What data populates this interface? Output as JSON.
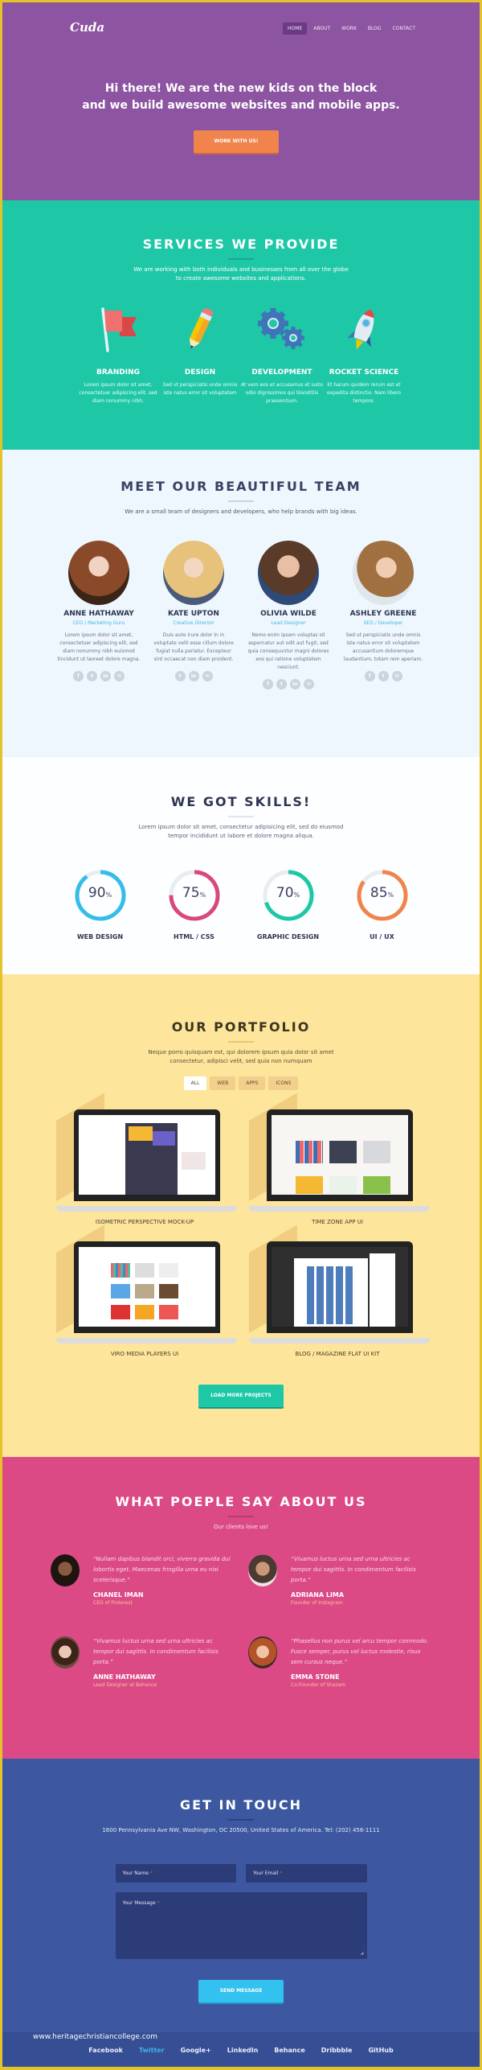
{
  "brand": {
    "logo": "Cuda"
  },
  "nav": {
    "items": [
      {
        "label": "HOME",
        "active": true
      },
      {
        "label": "ABOUT"
      },
      {
        "label": "WORK"
      },
      {
        "label": "BLOG"
      },
      {
        "label": "CONTACT"
      }
    ]
  },
  "hero": {
    "line1": "Hi there! We are the new kids on the block",
    "line2": "and we build awesome websites and mobile apps.",
    "cta": "WORK WITH US!"
  },
  "services": {
    "title": "SERVICES WE PROVIDE",
    "subtitle_1": "We are working with both individuals and businesses from all over the globe",
    "subtitle_2": "to create awesome websites and applications.",
    "items": [
      {
        "icon": "flag-icon",
        "title": "BRANDING",
        "text": "Lorem ipsum dolor sit amet, consectetuer adipiscing elit, sed diam nonummy nibh."
      },
      {
        "icon": "pencil-icon",
        "title": "DESIGN",
        "text": "Sed ut perspiciatis unde omnis iste natus error sit voluptatem"
      },
      {
        "icon": "gears-icon",
        "title": "DEVELOPMENT",
        "text": "At vero eos et accusamus et iusto odio dignissimos qui blanditiis praesentium."
      },
      {
        "icon": "rocket-icon",
        "title": "ROCKET SCIENCE",
        "text": "Et harum quidem rerum est et expedita distinctio. Nam libero tempore."
      }
    ]
  },
  "team": {
    "title": "MEET OUR BEAUTIFUL TEAM",
    "subtitle": "We are a small team of designers and developers, who help brands with big ideas.",
    "members": [
      {
        "name": "ANNE HATHAWAY",
        "role": "CEO / Marketing Guru",
        "bio": "Lorem ipsum dolor sit amet, consectetuer adipiscing elit, sed diam nonummy nibh euismod tincidunt ut laoreet dolore magna.",
        "socials": [
          "f",
          "t",
          "in",
          "✉"
        ]
      },
      {
        "name": "KATE UPTON",
        "role": "Creative Director",
        "bio": "Duis aute irure dolor in in voluptate velit esse cillum dolore fugiat nulla pariatur. Excepteur sint occaecat non diam proident.",
        "socials": [
          "t",
          "in",
          "✉"
        ]
      },
      {
        "name": "OLIVIA WILDE",
        "role": "Lead Designer",
        "bio": "Nemo enim ipsam voluptas sit aspernatur aut odit aut fugit, sed quia consequuntur magni dolores eos qui ratione voluptatem nesciunt.",
        "socials": [
          "f",
          "t",
          "in",
          "✉"
        ]
      },
      {
        "name": "ASHLEY GREENE",
        "role": "SEO / Developer",
        "bio": "Sed ut perspiciatis unde omnis iste natus error sit voluptatem accusantium doloremque laudantium, totam rem aperiam.",
        "socials": [
          "f",
          "t",
          "✉"
        ]
      }
    ]
  },
  "skills": {
    "title": "WE GOT SKILLS!",
    "subtitle_1": "Lorem ipsum dolor sit amet, consectetur adipisicing elit, sed do eiusmod",
    "subtitle_2": "tempor incididunt ut labore et dolore magna aliqua.",
    "items": [
      {
        "label": "WEB DESIGN",
        "value": 90,
        "color": "#35bde9"
      },
      {
        "label": "HTML / CSS",
        "value": 75,
        "color": "#d9477f"
      },
      {
        "label": "GRAPHIC DESIGN",
        "value": 70,
        "color": "#1ec8a7"
      },
      {
        "label": "UI / UX",
        "value": 85,
        "color": "#f0844c"
      }
    ],
    "track_color": "#e6eef3",
    "unit": "%"
  },
  "portfolio": {
    "title": "OUR PORTFOLIO",
    "subtitle_1": "Neque porro quisquam est, qui dolorem ipsum quia dolor sit amet",
    "subtitle_2": "consectetur, adipisci velit, sed quia non numquam",
    "filters": [
      {
        "label": "ALL",
        "active": true
      },
      {
        "label": "WEB"
      },
      {
        "label": "APPS"
      },
      {
        "label": "ICONS"
      }
    ],
    "items": [
      {
        "caption": "ISOMETRIC PERSPECTIVE MOCK-UP"
      },
      {
        "caption": "TIME ZONE APP UI"
      },
      {
        "caption": "VIRO MEDIA PLAYERS UI"
      },
      {
        "caption": "BLOG / MAGAZINE FLAT UI KIT"
      }
    ],
    "load_more": "LOAD MORE PROJECTS"
  },
  "testimonials": {
    "title": "WHAT POEPLE SAY ABOUT US",
    "subtitle": "Our clients love us!",
    "items": [
      {
        "quote": "“Nullam dapibus blandit orci, viverra gravida dui lobortis eget. Maecenas fringilla urna eu nisi scelerisque.”",
        "name": "CHANEL IMAN",
        "role": "CEO of Pinterest"
      },
      {
        "quote": "“Vivamus luctus urna sed urna ultricies ac tempor dui sagittis. In condimentum facilisis porta.”",
        "name": "ADRIANA LIMA",
        "role": "Founder of Instagram"
      },
      {
        "quote": "“Vivamus luctus urna sed urna ultricies ac tempor dui sagittis. In condimentum facilisis porta.”",
        "name": "ANNE HATHAWAY",
        "role": "Lead Designer at Behance"
      },
      {
        "quote": "“Phasellus non purus vel arcu tempor commodo. Fusce semper, purus vel luctus molestie, risus sem cursus neque.”",
        "name": "EMMA STONE",
        "role": "Co-Founder of Shazam"
      }
    ]
  },
  "contact": {
    "title": "GET IN TOUCH",
    "address": "1600 Pennsylvania Ave NW, Washington, DC 20500, United States of America. Tel: (202) 456-1111",
    "name_placeholder": "Your Name",
    "email_placeholder": "Your Email",
    "message_placeholder": "Your Message",
    "required_mark": "*",
    "send": "SEND MESSAGE"
  },
  "footer": {
    "watermark": "www.heritagechristiancollege.com",
    "links": [
      {
        "label": "Facebook"
      },
      {
        "label": "Twitter",
        "highlight": true
      },
      {
        "label": "Google+"
      },
      {
        "label": "LinkedIn"
      },
      {
        "label": "Behance"
      },
      {
        "label": "Dribbble"
      },
      {
        "label": "GitHub"
      }
    ]
  }
}
